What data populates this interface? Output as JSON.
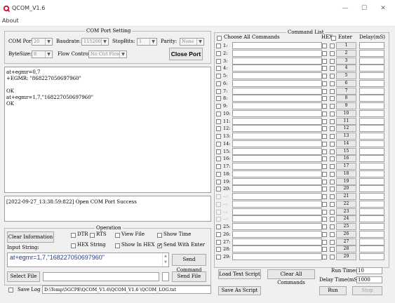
{
  "window": {
    "title": "QCOM_V1.6",
    "minimize": "—",
    "maximize": "☐",
    "close": "✕"
  },
  "menu": {
    "about": "About"
  },
  "port_settings": {
    "title": "COM Port Setting",
    "com_port_label": "COM Port:",
    "com_port_value": "20",
    "baudrate_label": "Baudrate:",
    "baudrate_value": "115200",
    "stopbits_label": "StopBits:",
    "stopbits_value": "1",
    "parity_label": "Parity:",
    "parity_value": "None",
    "bytesize_label": "ByteSize:",
    "bytesize_value": "8",
    "flow_control_label": "Flow Control:",
    "flow_control_value": "No Ctrl Flow",
    "close_port_button": "Close Port"
  },
  "receive_log": {
    "lines": [
      "at+egmr=0,7",
      "+EGMR: \"868227050697960\"",
      "",
      "OK",
      "at+egmr=1,7,\"168227050697960\"",
      "OK"
    ]
  },
  "status_log": {
    "text": "[2022-09-27_13:38:59:822] Open COM Port Success"
  },
  "operation": {
    "title": "Operation",
    "clear_info_button": "Clear Information",
    "dtr": "DTR",
    "rts": "RTS",
    "view_file": "View File",
    "show_time": "Show Time",
    "input_string_label": "Input String:",
    "hex_string": "HEX String",
    "show_in_hex": "Show In HEX",
    "send_with_enter": "Send With Enter",
    "input_value": "at+egmr=1,7,\"168227050697960\"",
    "send_command_button": "Send Command",
    "select_file_button": "Select File",
    "send_file_button": "Send File",
    "save_log_label": "Save Log",
    "log_path": "D:\\Temp\\5GCPE\\QCOM_V1.6\\QCOM_V1.6 \\QCOM_LOG.txt"
  },
  "command_list": {
    "title": "Command List",
    "choose_all": "Choose All Commands",
    "hex_header": "HEX",
    "enter_header": "Enter",
    "delay_header": "Delay(mS)",
    "rows": [
      {
        "num": "1:",
        "btn": "1"
      },
      {
        "num": "2:",
        "btn": "2"
      },
      {
        "num": "3:",
        "btn": "3"
      },
      {
        "num": "4:",
        "btn": "4"
      },
      {
        "num": "5:",
        "btn": "5"
      },
      {
        "num": "6:",
        "btn": "6"
      },
      {
        "num": "7:",
        "btn": "7"
      },
      {
        "num": "8:",
        "btn": "8"
      },
      {
        "num": "9:",
        "btn": "9"
      },
      {
        "num": "10:",
        "btn": "10"
      },
      {
        "num": "11:",
        "btn": "11"
      },
      {
        "num": "12:",
        "btn": "12"
      },
      {
        "num": "13:",
        "btn": "13"
      },
      {
        "num": "14:",
        "btn": "14"
      },
      {
        "num": "15:",
        "btn": "15"
      },
      {
        "num": "16:",
        "btn": "16"
      },
      {
        "num": "17:",
        "btn": "17"
      },
      {
        "num": "18:",
        "btn": "18"
      },
      {
        "num": "19:",
        "btn": "19"
      },
      {
        "num": "20:",
        "btn": "20"
      },
      {
        "num": "--:",
        "btn": "21"
      },
      {
        "num": "--:",
        "btn": "22"
      },
      {
        "num": "--:",
        "btn": "23"
      },
      {
        "num": "--:",
        "btn": "24"
      },
      {
        "num": "25:",
        "btn": "25"
      },
      {
        "num": "26:",
        "btn": "26"
      },
      {
        "num": "27:",
        "btn": "27"
      },
      {
        "num": "28:",
        "btn": "28"
      },
      {
        "num": "29:",
        "btn": "29"
      }
    ],
    "load_text_script_button": "Load Text Script",
    "clear_all_commands_button": "Clear All Commands",
    "run_times_label": "Run Times:",
    "run_times_value": "10",
    "delay_time_label": "Delay Time(mS):",
    "delay_time_value": "1000",
    "save_as_script_button": "Save As Script",
    "run_button": "Run",
    "stop_button": "Stop"
  }
}
